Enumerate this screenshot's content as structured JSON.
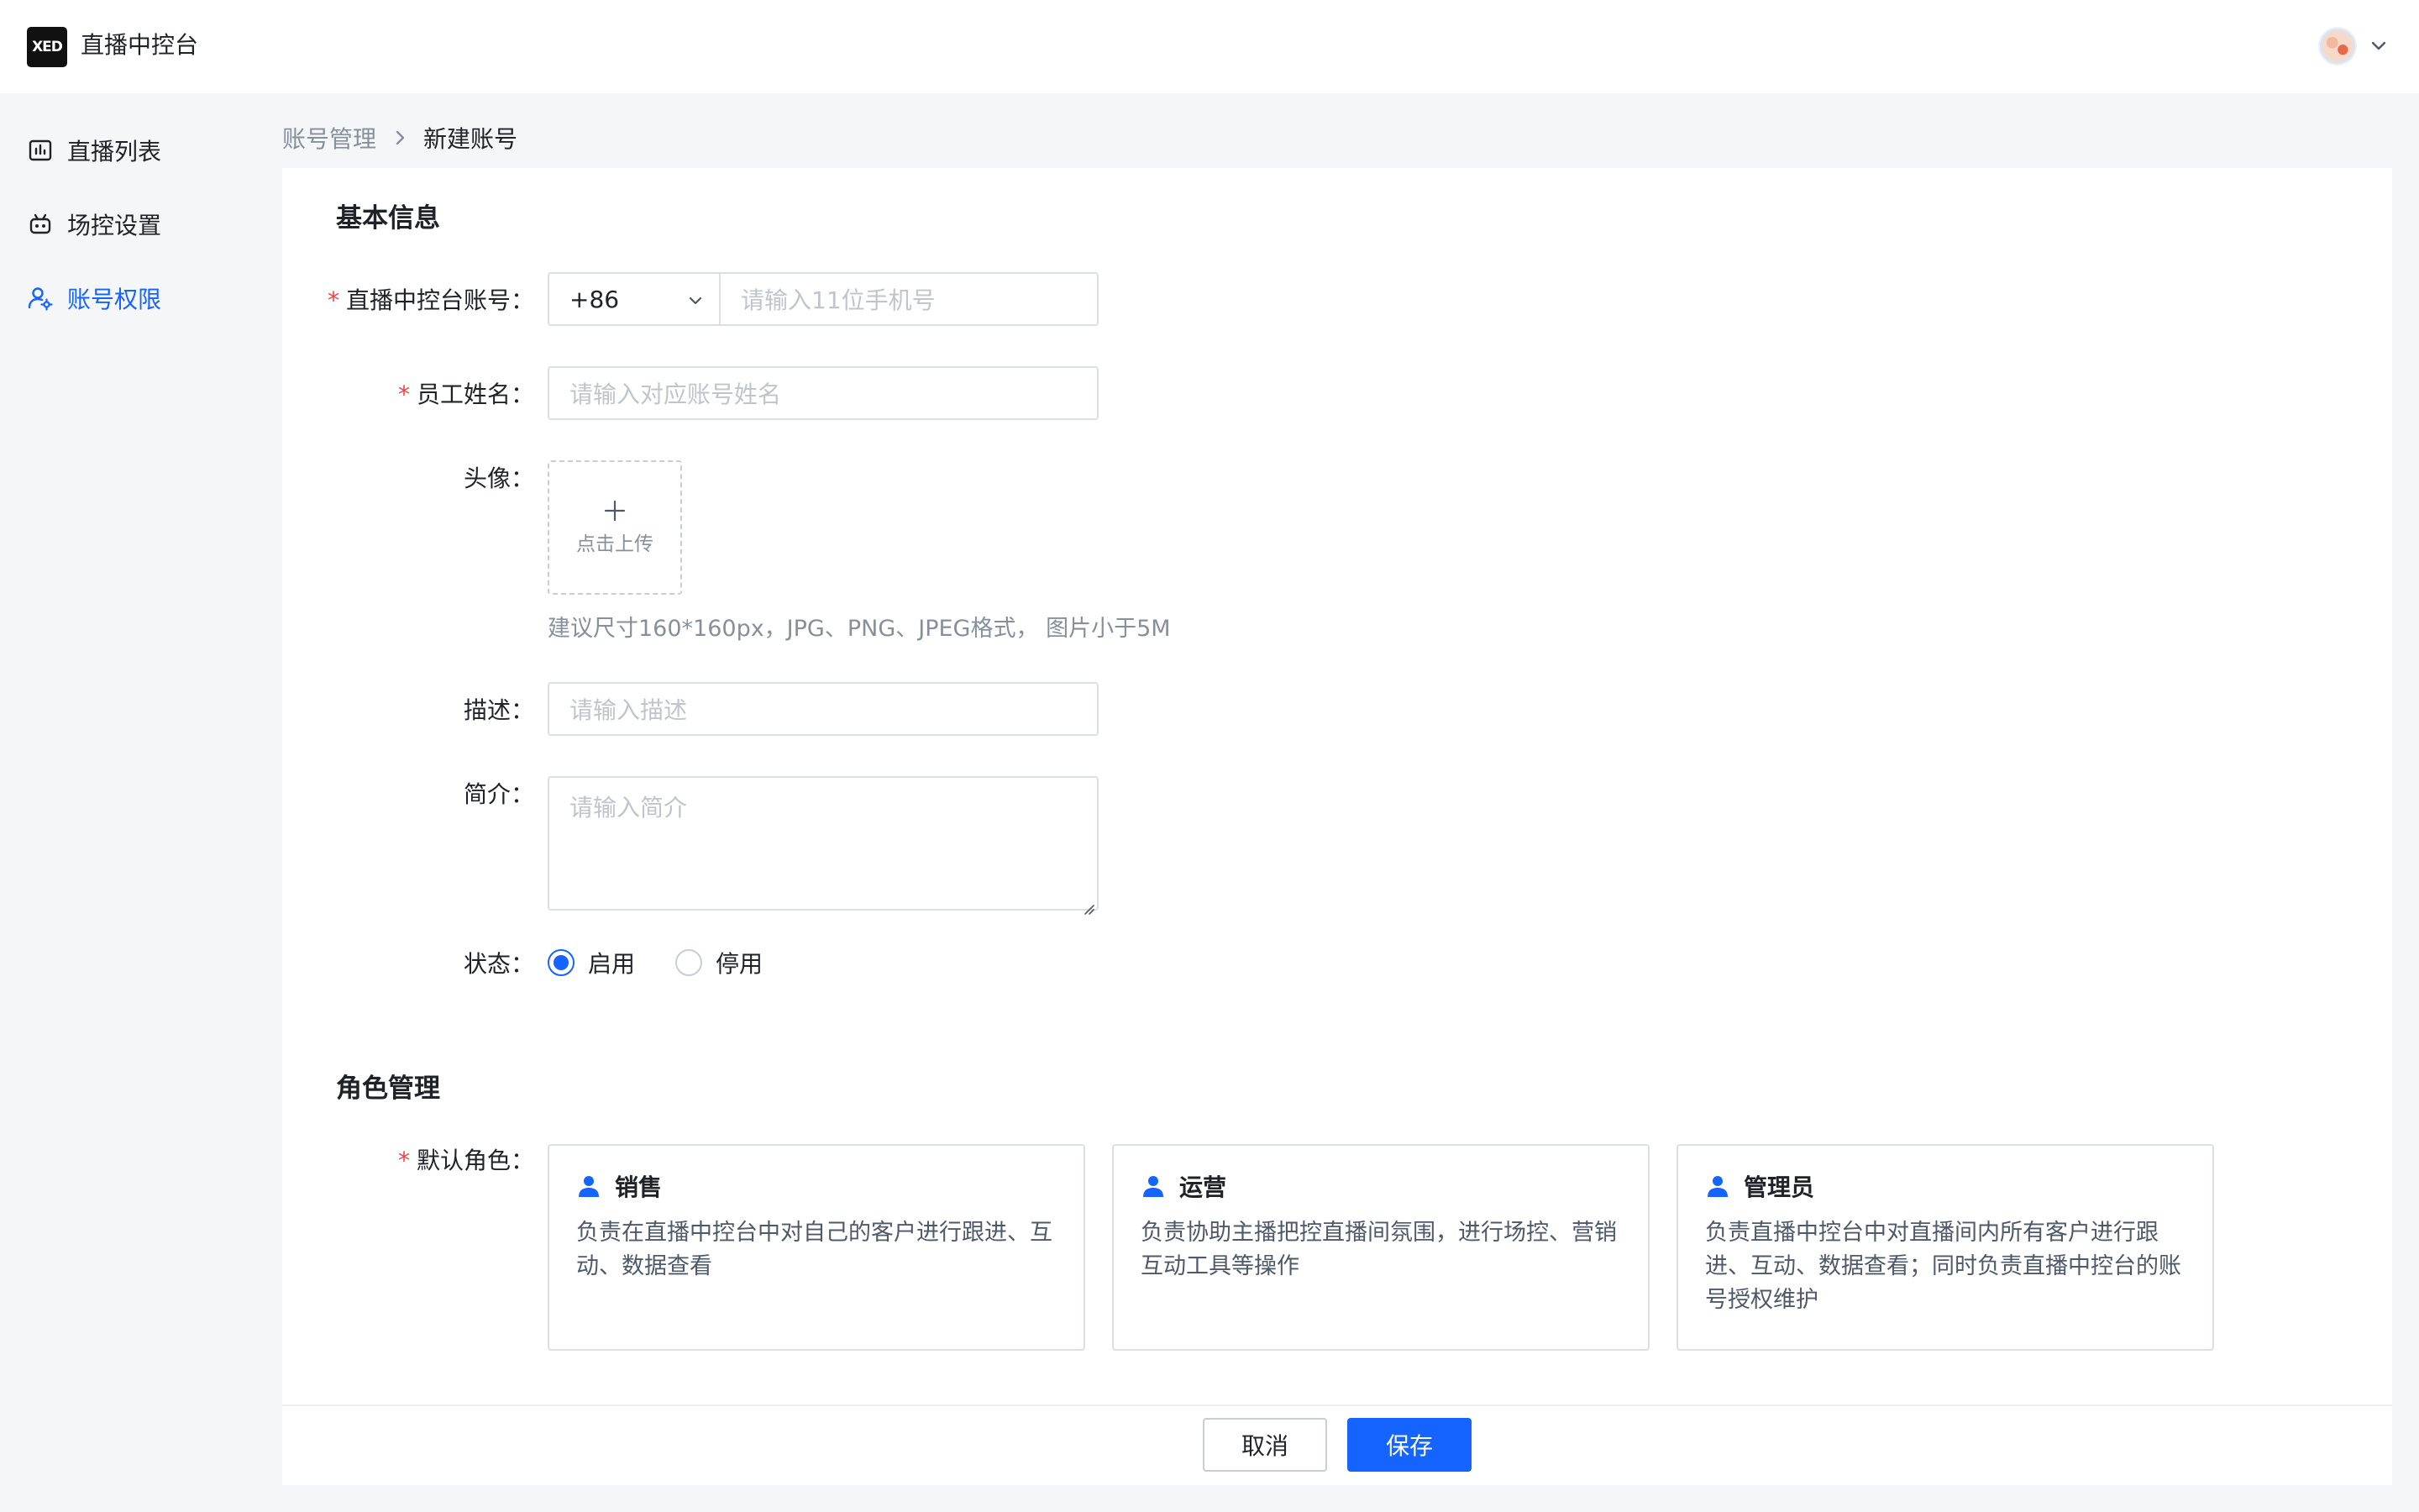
{
  "header": {
    "logo_text": "XED",
    "app_title": "直播中控台"
  },
  "sidebar": {
    "items": [
      {
        "label": "直播列表",
        "icon": "chart-icon"
      },
      {
        "label": "场控设置",
        "icon": "robot-icon"
      },
      {
        "label": "账号权限",
        "icon": "user-settings-icon",
        "active": true
      }
    ]
  },
  "breadcrumb": {
    "parent": "账号管理",
    "current": "新建账号"
  },
  "form": {
    "basic_section_title": "基本信息",
    "account": {
      "label": "直播中控台账号：",
      "required": "*",
      "country_code": "+86",
      "phone_placeholder": "请输入11位手机号"
    },
    "name": {
      "label": "员工姓名：",
      "required": "*",
      "placeholder": "请输入对应账号姓名"
    },
    "avatar": {
      "label": "头像：",
      "upload_text": "点击上传",
      "hint": "建议尺寸160*160px，JPG、PNG、JPEG格式， 图片小于5M"
    },
    "description": {
      "label": "描述：",
      "placeholder": "请输入描述"
    },
    "intro": {
      "label": "简介：",
      "placeholder": "请输入简介"
    },
    "status": {
      "label": "状态：",
      "options": [
        {
          "label": "启用",
          "checked": true
        },
        {
          "label": "停用",
          "checked": false
        }
      ]
    },
    "role_section_title": "角色管理",
    "roles": {
      "label": "默认角色：",
      "required": "*",
      "cards": [
        {
          "title": "销售",
          "description": "负责在直播中控台中对自己的客户进行跟进、互动、数据查看"
        },
        {
          "title": "运营",
          "description": "负责协助主播把控直播间氛围，进行场控、营销互动工具等操作"
        },
        {
          "title": "管理员",
          "description": "负责直播中控台中对直播间内所有客户进行跟进、互动、数据查看；同时负责直播中控台的账号授权维护"
        }
      ]
    }
  },
  "footer": {
    "cancel_label": "取消",
    "save_label": "保存"
  },
  "colors": {
    "primary": "#1664ff",
    "required": "#f53f3f",
    "border": "#dcdfe6",
    "placeholder": "#c0c4cc"
  }
}
